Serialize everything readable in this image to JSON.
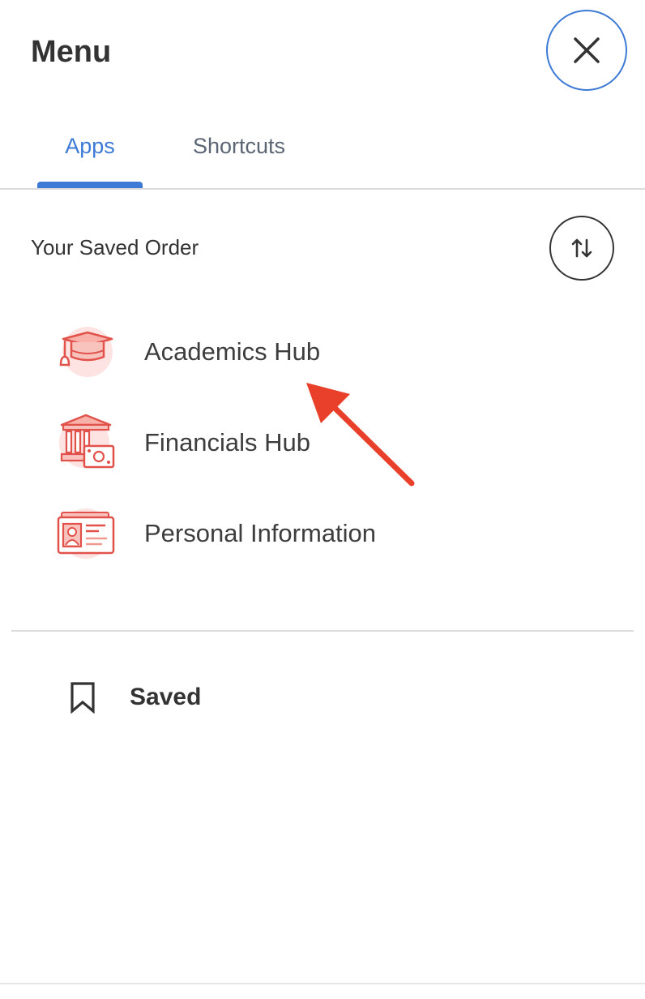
{
  "header": {
    "title": "Menu",
    "close_icon": "close-icon"
  },
  "tabs": [
    {
      "label": "Apps",
      "active": true
    },
    {
      "label": "Shortcuts",
      "active": false
    }
  ],
  "saved_order": {
    "label": "Your Saved Order",
    "reorder_icon": "swap-vertical-icon"
  },
  "apps": [
    {
      "label": "Academics Hub",
      "icon": "graduation-cap-icon"
    },
    {
      "label": "Financials Hub",
      "icon": "bank-money-icon"
    },
    {
      "label": "Personal Information",
      "icon": "id-card-icon"
    }
  ],
  "saved": {
    "label": "Saved",
    "icon": "bookmark-icon"
  },
  "colors": {
    "accent": "#3c7ad6",
    "app_icon": "#e0524a",
    "app_icon_bg": "#fde3e1",
    "annotation": "#e8402a"
  }
}
